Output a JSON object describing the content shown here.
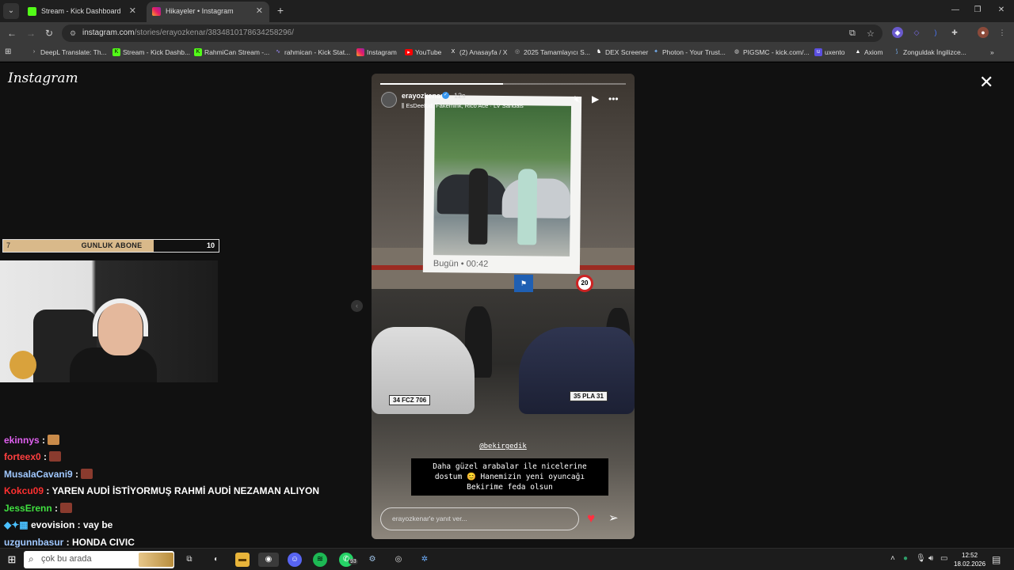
{
  "browser": {
    "tabs": [
      {
        "label": "Stream - Kick Dashboard",
        "close": "✕"
      },
      {
        "label": "Hikayeler • Instagram",
        "close": "✕"
      }
    ],
    "url_host": "instagram.com",
    "url_path": "/stories/erayozkenar/3834810178634258296/",
    "bookmarks": [
      "DeepL Translate: Th...",
      "Stream - Kick Dashb...",
      "RahmiCan Stream -...",
      "rahmican - Kick Stat...",
      "Instagram",
      "YouTube",
      "(2) Anasayfa / X",
      "2025 Tamamlayıcı S...",
      "DEX Screener",
      "Photon - Your Trust...",
      "PIGSMC - kick.com/...",
      "uxento",
      "Axiom",
      "Zonguldak İngilizce..."
    ]
  },
  "instagram": {
    "logo": "Instagram",
    "story": {
      "username": "erayozkenar",
      "time": "12s",
      "music": "EsDeeKid, Fakemink, Rico Ace · LV Sandals",
      "polaroid_date": "Bugün • 00:42",
      "progress_fraction": 0.5,
      "mention": "@bekirgedik",
      "caption_lines": [
        "Daha güzel arabalar ile nicelerine",
        "dostum 😊 Hanemizin yeni oyuncağı",
        "Bekirime feda olsun"
      ],
      "plate_left": "34 FCZ 706",
      "plate_right": "35 PLA 31",
      "speed_sign": "20",
      "reply_placeholder": "erayozkenar'e yanıt ver..."
    }
  },
  "stream": {
    "sub_goal_label": "GUNLUK ABONE",
    "sub_current": "7",
    "sub_target": "10",
    "sub_fraction": 0.7,
    "chat": [
      {
        "user": "ekinnys",
        "text": "",
        "color": "#e060f0"
      },
      {
        "user": "forteex0",
        "text": "",
        "color": "#ff4040"
      },
      {
        "user": "MusalaCavani9",
        "text": "",
        "color": "#a0c8ff"
      },
      {
        "user": "Kokcu09",
        "text": "YAREN AUDİ İSTİYORMUŞ RAHMİ AUDİ NEZAMAN ALIYON",
        "color": "#ff3030"
      },
      {
        "user": "JessErenn",
        "text": "",
        "color": "#40e040"
      },
      {
        "user": "evovision",
        "text": "vay be",
        "color": "#ffffff"
      },
      {
        "user": "uzgunnbasur",
        "text": "HONDA CIVIC",
        "color": "#a0c8ff"
      }
    ]
  },
  "taskbar": {
    "search_text": "çok bu arada",
    "badge": "93",
    "time": "12:52",
    "date": "18.02.2026"
  }
}
